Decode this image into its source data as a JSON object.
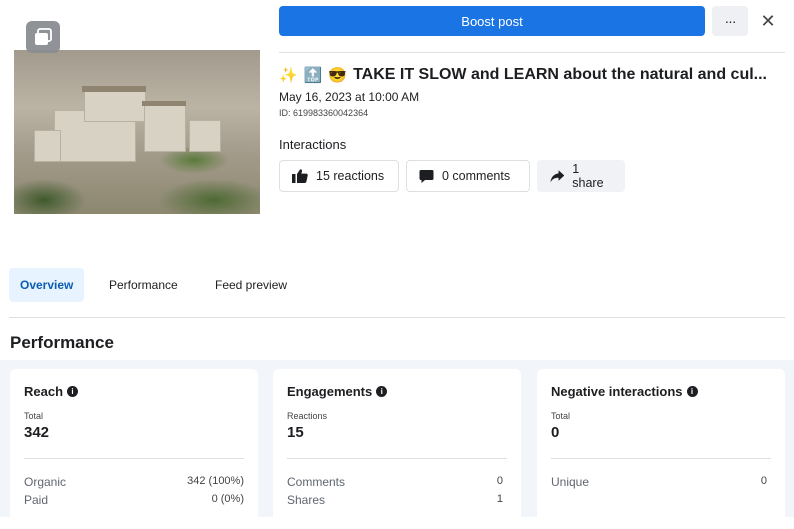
{
  "header": {
    "boost_label": "Boost post",
    "more_label": "···",
    "close_label": "✕"
  },
  "post": {
    "emoji_1": "✨",
    "emoji_2": "🔝",
    "emoji_3": "😎",
    "title": "TAKE IT SLOW and LEARN about the natural and cul...",
    "date": "May 16, 2023 at 10:00 AM",
    "id": "ID: 619983360042364"
  },
  "interactions": {
    "label": "Interactions",
    "reactions": "15 reactions",
    "comments": "0 comments",
    "shares": "1 share"
  },
  "tabs": [
    {
      "label": "Overview",
      "active": true
    },
    {
      "label": "Performance",
      "active": false
    },
    {
      "label": "Feed preview",
      "active": false
    }
  ],
  "performance": {
    "title": "Performance",
    "cards": [
      {
        "title": "Reach",
        "sublabel": "Total",
        "value": "342",
        "rows": [
          {
            "label": "Organic",
            "value": "342 (100%)"
          },
          {
            "label": "Paid",
            "value": "0 (0%)"
          }
        ]
      },
      {
        "title": "Engagements",
        "sublabel": "Reactions",
        "value": "15",
        "rows": [
          {
            "label": "Comments",
            "value": "0"
          },
          {
            "label": "Shares",
            "value": "1"
          }
        ]
      },
      {
        "title": "Negative interactions",
        "sublabel": "Total",
        "value": "0",
        "rows": [
          {
            "label": "Unique",
            "value": "0"
          }
        ]
      }
    ]
  },
  "colors": {
    "primary": "#1b74e4",
    "tab_active_bg": "#e7f3ff",
    "tab_active_text": "#0a5eb5"
  }
}
